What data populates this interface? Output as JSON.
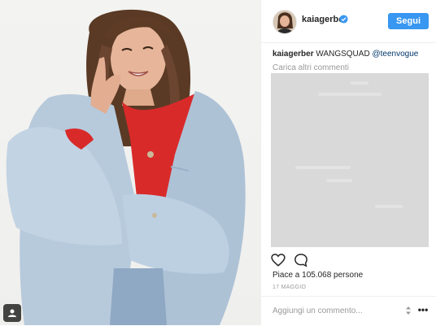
{
  "post": {
    "username": "kaiagerber",
    "follow_label": "Segui",
    "caption_text": "WANGSQUAD",
    "caption_mention": "@teenvogue",
    "load_more_label": "Carica altri commenti",
    "likes_text": "Piace a 105.068 persone",
    "date": "17 MAGGIO",
    "comment_placeholder": "Aggiungi un commento...",
    "icons": [
      "person-tag-icon",
      "verified-badge-icon",
      "heart-icon",
      "comment-icon",
      "sort-arrows-icon",
      "more-options-icon"
    ]
  },
  "colors": {
    "accent": "#3897f0",
    "mention": "#003569",
    "muted_text": "#999999",
    "comments_placeholder_bg": "#d9d9d9"
  }
}
